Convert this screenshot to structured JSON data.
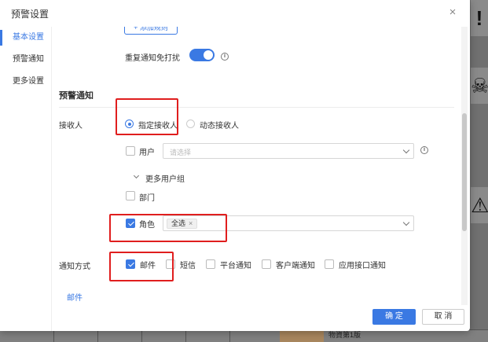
{
  "modal": {
    "title": "预警设置",
    "close_glyph": "×"
  },
  "side_nav": {
    "items": [
      {
        "label": "基本设置",
        "active": true
      },
      {
        "label": "预警通知",
        "active": false
      },
      {
        "label": "更多设置",
        "active": false
      }
    ]
  },
  "basic": {
    "add_button_label": "+ 添加规则",
    "repeat_notify_label": "重复通知免打扰",
    "repeat_notify_on": true,
    "info_glyph": "i"
  },
  "alert_notify": {
    "section_title": "预警通知",
    "receiver_label": "接收人",
    "receiver_options": [
      {
        "label": "指定接收人",
        "checked": true
      },
      {
        "label": "动态接收人",
        "checked": false
      }
    ],
    "user": {
      "label": "用户",
      "checked": false,
      "placeholder": "请选择"
    },
    "more_groups_label": "更多用户组",
    "dept": {
      "label": "部门",
      "checked": false
    },
    "role": {
      "label": "角色",
      "checked": true,
      "tag_label": "全选",
      "tag_close": "×"
    },
    "method_label": "通知方式",
    "methods": [
      {
        "label": "邮件",
        "checked": true
      },
      {
        "label": "短信",
        "checked": false
      },
      {
        "label": "平台通知",
        "checked": false
      },
      {
        "label": "客户端通知",
        "checked": false
      },
      {
        "label": "应用接口通知",
        "checked": false
      }
    ],
    "active_tab": "邮件"
  },
  "footer": {
    "confirm_label": "确 定",
    "cancel_label": "取 消"
  },
  "background": {
    "bottom_text": "物資第1版"
  },
  "colors": {
    "accent": "#3a79e3",
    "highlight": "#e01e1e"
  }
}
